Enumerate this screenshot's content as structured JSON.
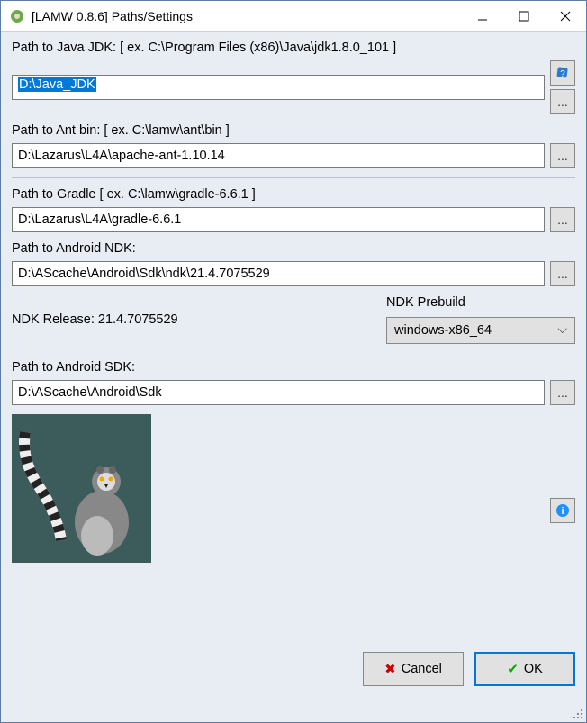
{
  "window": {
    "title": "[LAMW 0.8.6] Paths/Settings"
  },
  "jdk": {
    "label": "Path to Java JDK:  [ ex.  C:\\Program Files (x86)\\Java\\jdk1.8.0_101 ]",
    "value": "D:\\Java_JDK"
  },
  "ant": {
    "label": "Path to Ant bin: [ ex.   C:\\lamw\\ant\\bin ]",
    "value": "D:\\Lazarus\\L4A\\apache-ant-1.10.14"
  },
  "gradle": {
    "label": "Path to Gradle [ ex. C:\\lamw\\gradle-6.6.1 ]",
    "value": "D:\\Lazarus\\L4A\\gradle-6.6.1"
  },
  "ndk": {
    "label": "Path to Android NDK:",
    "value": "D:\\AScache\\Android\\Sdk\\ndk\\21.4.7075529",
    "release_label": "NDK Release: 21.4.7075529",
    "prebuild_label": "NDK Prebuild",
    "prebuild_value": "windows-x86_64"
  },
  "sdk": {
    "label": "Path to Android SDK:",
    "value": "D:\\AScache\\Android\\Sdk"
  },
  "buttons": {
    "browse": "...",
    "cancel": "Cancel",
    "ok": "OK"
  }
}
